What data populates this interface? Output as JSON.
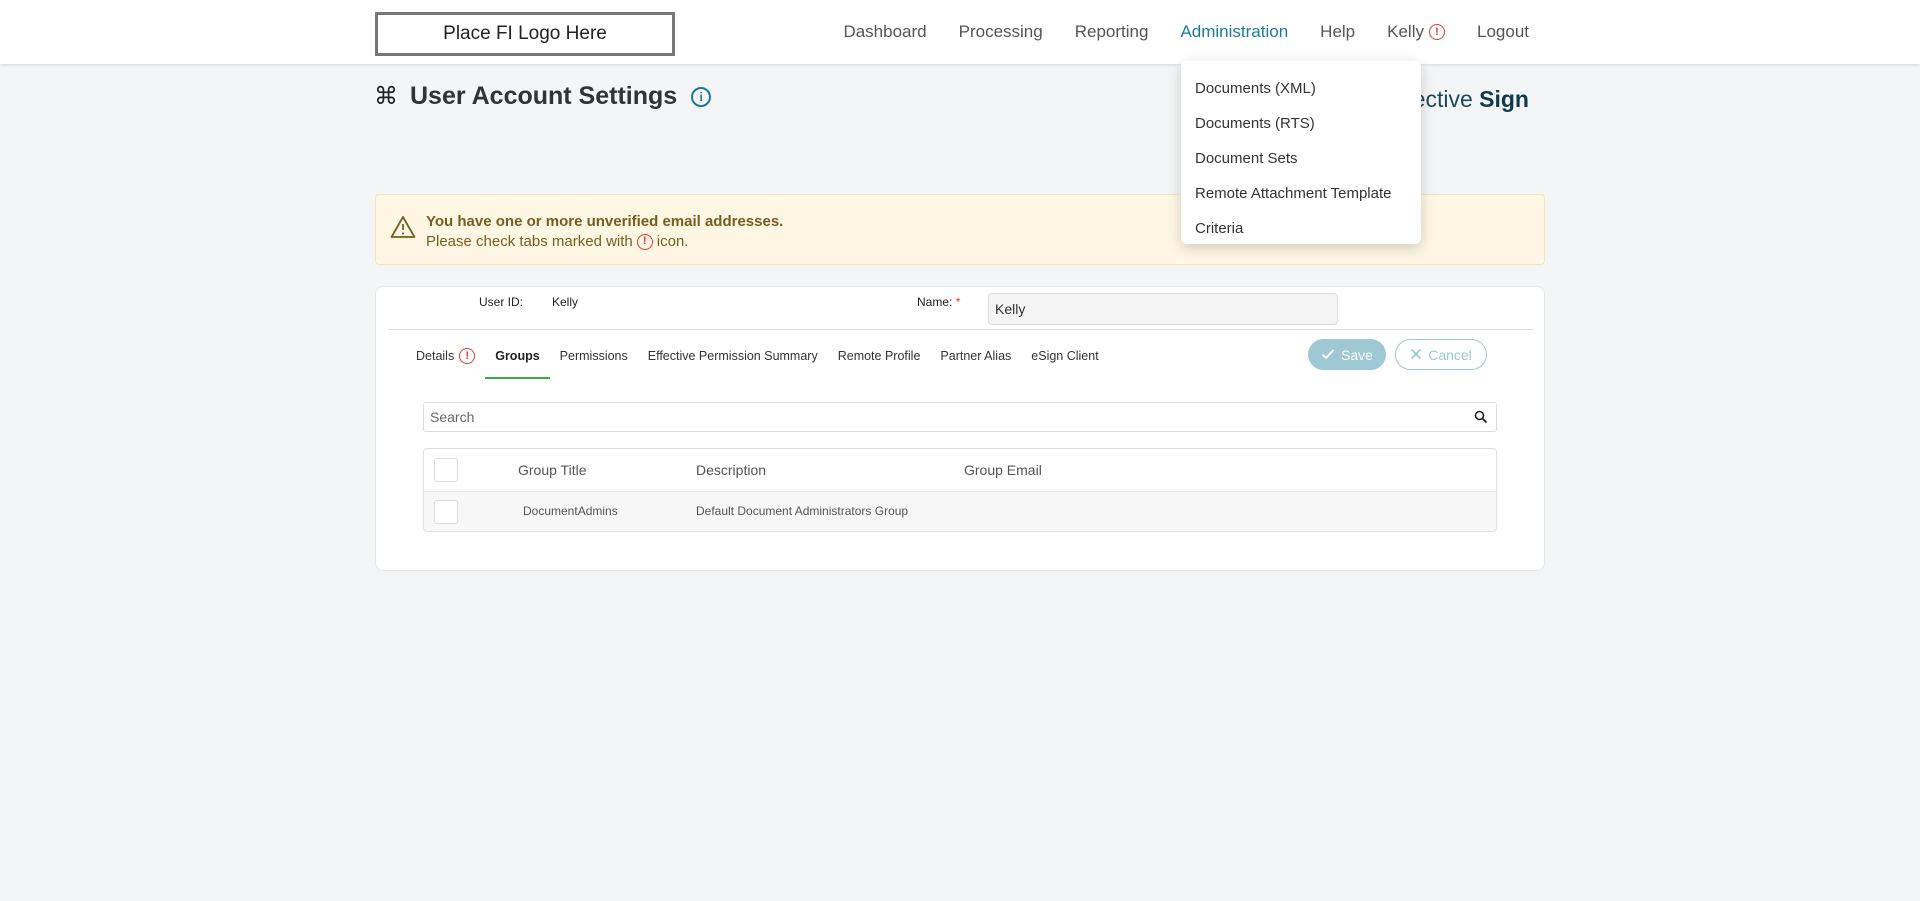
{
  "header": {
    "logo_text": "Place FI Logo Here",
    "nav": [
      {
        "label": "Dashboard"
      },
      {
        "label": "Processing"
      },
      {
        "label": "Reporting"
      },
      {
        "label": "Administration"
      },
      {
        "label": "Help"
      },
      {
        "label": "Kelly"
      },
      {
        "label": "Logout"
      }
    ],
    "alert_glyph": "!"
  },
  "admin_menu": {
    "items": [
      {
        "label": "Documents (XML)"
      },
      {
        "label": "Documents (RTS)"
      },
      {
        "label": "Document Sets"
      },
      {
        "label": "Remote Attachment Template"
      },
      {
        "label": "Criteria"
      }
    ]
  },
  "page": {
    "title": "User Account Settings",
    "info_glyph": "i",
    "brand_light": "ective ",
    "brand_bold": "Sign"
  },
  "banner": {
    "title": "You have one or more unverified email addresses.",
    "text_before": "Please check tabs marked with",
    "text_after": "icon."
  },
  "user": {
    "id_label": "User ID:",
    "id_value": "Kelly",
    "name_label": "Name:",
    "required_mark": "*",
    "name_value": "Kelly"
  },
  "tabs": [
    {
      "label": "Details"
    },
    {
      "label": "Groups"
    },
    {
      "label": "Permissions"
    },
    {
      "label": "Effective Permission Summary"
    },
    {
      "label": "Remote Profile"
    },
    {
      "label": "Partner Alias"
    },
    {
      "label": "eSign Client"
    }
  ],
  "actions": {
    "save_label": "Save",
    "cancel_label": "Cancel"
  },
  "search": {
    "placeholder": "Search"
  },
  "groups_table": {
    "columns": [
      "Group Title",
      "Description",
      "Group Email"
    ],
    "rows": [
      {
        "title": "DocumentAdmins",
        "description": "Default Document Administrators Group",
        "email": ""
      }
    ]
  },
  "colors": {
    "accent": "#1b7a99",
    "alert": "#e53935",
    "active_tab": "#3ea84b",
    "banner_bg": "#fdf7e3"
  }
}
